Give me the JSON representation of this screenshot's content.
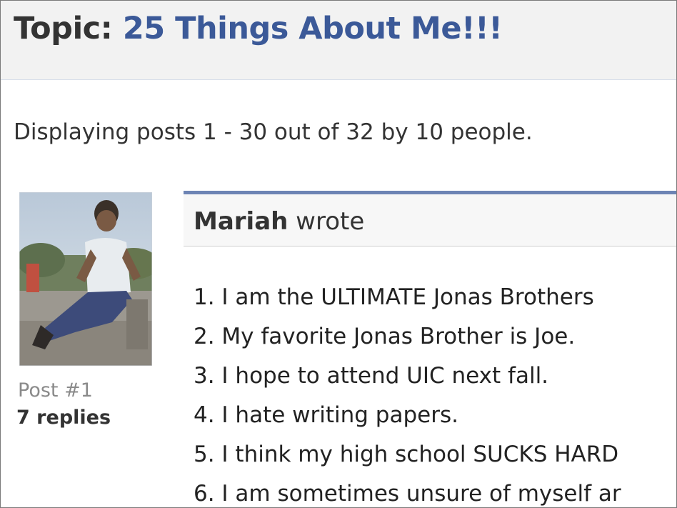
{
  "topic": {
    "prefix": "Topic:",
    "title": "25 Things About Me!!!"
  },
  "display_info": "Displaying posts 1 - 30 out of 32 by 10 people.",
  "post": {
    "author": "Mariah",
    "verb": "wrote",
    "post_number": "Post #1",
    "replies": "7 replies",
    "items": [
      "1. I am the ULTIMATE Jonas Brothers",
      "2. My favorite Jonas Brother is Joe.",
      "3. I hope to attend UIC next fall.",
      "4. I hate writing papers.",
      "5. I think my high school SUCKS HARD",
      "6. I am sometimes unsure of myself ar"
    ]
  },
  "colors": {
    "link_blue": "#3b5998",
    "header_bg": "#f2f2f2",
    "rule_blue": "#6d84b4"
  }
}
